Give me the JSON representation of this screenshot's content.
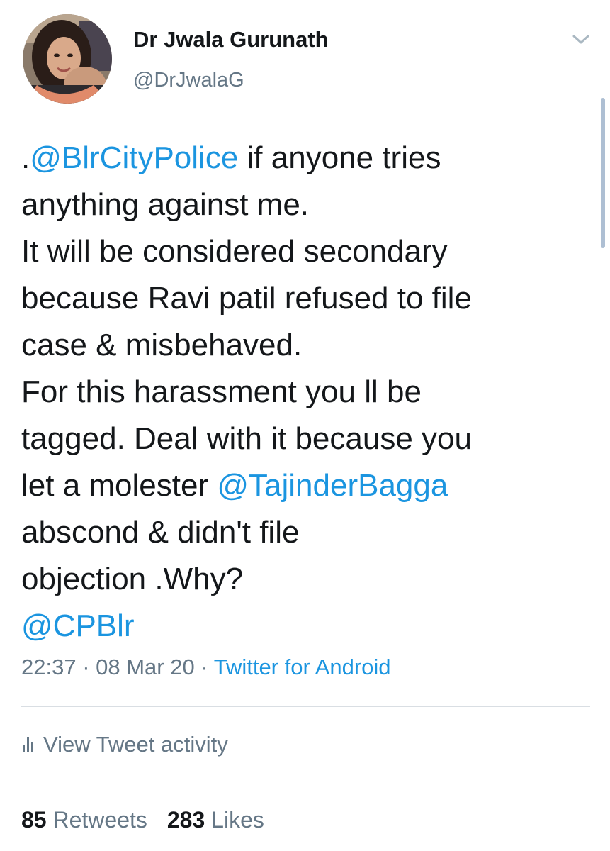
{
  "author": {
    "display_name": "Dr Jwala Gurunath",
    "handle": "@DrJwalaG",
    "avatar_icon": "profile-photo"
  },
  "tweet": {
    "lines": [
      [
        {
          "text": ".",
          "type": "text"
        },
        {
          "text": "@BlrCityPolice",
          "type": "mention"
        },
        {
          "text": " if anyone tries",
          "type": "text"
        }
      ],
      [
        {
          "text": "anything against me.",
          "type": "text"
        }
      ],
      [
        {
          "text": "It will be considered secondary",
          "type": "text"
        }
      ],
      [
        {
          "text": "because Ravi patil refused to file",
          "type": "text"
        }
      ],
      [
        {
          "text": "case & misbehaved.",
          "type": "text"
        }
      ],
      [
        {
          "text": "For this harassment you ll be",
          "type": "text"
        }
      ],
      [
        {
          "text": "tagged. Deal with it because you",
          "type": "text"
        }
      ],
      [
        {
          "text": "let a molester ",
          "type": "text"
        },
        {
          "text": "@TajinderBagga",
          "type": "mention"
        }
      ],
      [
        {
          "text": "abscond & didn't file",
          "type": "text"
        }
      ],
      [
        {
          "text": "objection .Why?",
          "type": "text"
        }
      ],
      [
        {
          "text": "@CPBlr",
          "type": "mention"
        }
      ]
    ]
  },
  "meta": {
    "time": "22:37",
    "separator": " · ",
    "date": "08 Mar 20",
    "source": "Twitter for Android"
  },
  "activity": {
    "label": "View Tweet activity",
    "icon": "bar-chart-icon"
  },
  "stats": {
    "retweets_count": "85",
    "retweets_label": "Retweets",
    "likes_count": "283",
    "likes_label": "Likes"
  },
  "colors": {
    "link": "#1b95e0",
    "secondary_text": "#657786",
    "primary_text": "#14171a"
  }
}
